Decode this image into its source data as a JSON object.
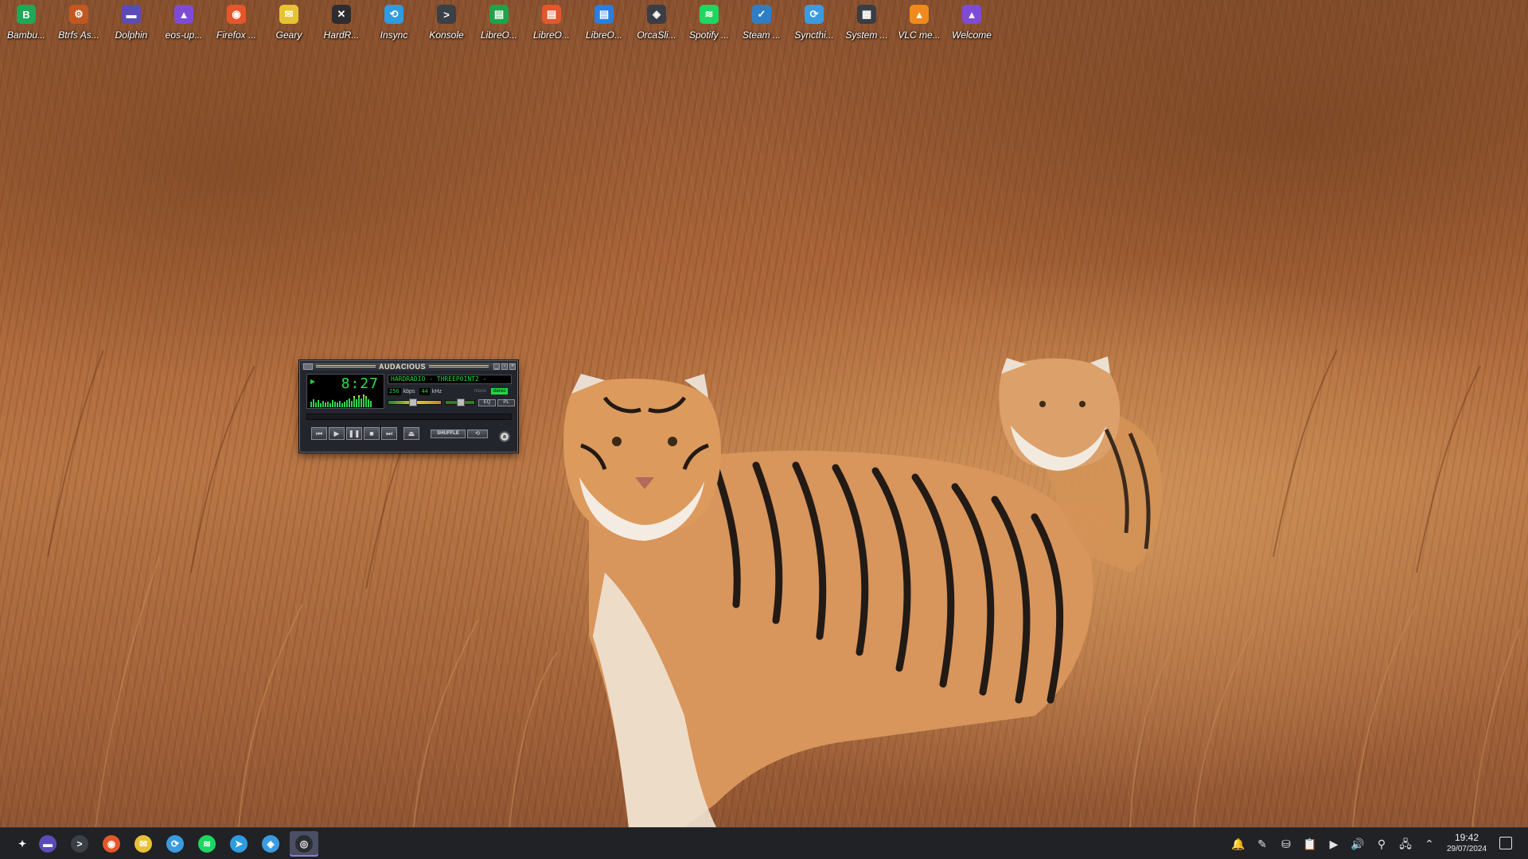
{
  "desktop": {
    "icons": [
      {
        "label": "Bambu...",
        "icon": "bambu-studio-icon",
        "color": "#1fa855",
        "glyph": "B"
      },
      {
        "label": "Btrfs As...",
        "icon": "btrfs-assistant-icon",
        "color": "#c2571f",
        "glyph": "⚙"
      },
      {
        "label": "Dolphin",
        "icon": "dolphin-folder-icon",
        "color": "#5a4bb8",
        "glyph": "▬"
      },
      {
        "label": "eos-up...",
        "icon": "eos-update-icon",
        "color": "#7e4bd6",
        "glyph": "▲"
      },
      {
        "label": "Firefox ...",
        "icon": "firefox-icon",
        "color": "#e5562a",
        "glyph": "◉"
      },
      {
        "label": "Geary",
        "icon": "geary-mail-icon",
        "color": "#e8c235",
        "glyph": "✉"
      },
      {
        "label": "HardR...",
        "icon": "hardrive-icon",
        "color": "#2d2d30",
        "glyph": "✕"
      },
      {
        "label": "Insync",
        "icon": "insync-icon",
        "color": "#2f9be0",
        "glyph": "⟲"
      },
      {
        "label": "Konsole",
        "icon": "konsole-terminal-icon",
        "color": "#3b3f46",
        "glyph": ">"
      },
      {
        "label": "LibreO...",
        "icon": "libreoffice-calc-icon",
        "color": "#1fa34a",
        "glyph": "▤"
      },
      {
        "label": "LibreO...",
        "icon": "libreoffice-impress-icon",
        "color": "#e2572c",
        "glyph": "▤"
      },
      {
        "label": "LibreO...",
        "icon": "libreoffice-writer-icon",
        "color": "#2a7ee0",
        "glyph": "▤"
      },
      {
        "label": "OrcaSli...",
        "icon": "orcaslicer-icon",
        "color": "#3a3d44",
        "glyph": "◈"
      },
      {
        "label": "Spotify ...",
        "icon": "spotify-icon",
        "color": "#1ed760",
        "glyph": "≋"
      },
      {
        "label": "Steam ...",
        "icon": "steam-icon",
        "color": "#2f7ec4",
        "glyph": "✓"
      },
      {
        "label": "Syncthi...",
        "icon": "syncthing-icon",
        "color": "#3b9be0",
        "glyph": "⟳"
      },
      {
        "label": "System ...",
        "icon": "system-monitor-icon",
        "color": "#3a3d44",
        "glyph": "▦"
      },
      {
        "label": "VLC me...",
        "icon": "vlc-cone-icon",
        "color": "#f08a1c",
        "glyph": "▲"
      },
      {
        "label": "Welcome",
        "icon": "welcome-icon",
        "color": "#7e4bd6",
        "glyph": "▲"
      }
    ]
  },
  "player": {
    "title": "AUDACIOUS",
    "time": "8:27",
    "song": "HARDRADIO - THREEPOINT2 -",
    "bitrate": "256",
    "bitrate_unit": "kbps",
    "samplerate": "44",
    "samplerate_unit": "kHz",
    "mono_label": "mono",
    "stereo_label": "stereo",
    "eq_label": "EQ",
    "pl_label": "PL",
    "shuffle_label": "SHUFFLE",
    "volume_level": 0.45,
    "balance_level": 0.5
  },
  "taskbar": {
    "apps": [
      {
        "icon": "app-launcher-icon",
        "glyph": "✦",
        "color": "#202226"
      },
      {
        "icon": "dolphin-folder-icon",
        "glyph": "▬",
        "color": "#5a4bb8"
      },
      {
        "icon": "konsole-terminal-icon",
        "glyph": ">",
        "color": "#3b3f46"
      },
      {
        "icon": "firefox-icon",
        "glyph": "◉",
        "color": "#e5562a"
      },
      {
        "icon": "geary-mail-icon",
        "glyph": "✉",
        "color": "#e8c235"
      },
      {
        "icon": "syncthing-icon",
        "glyph": "⟳",
        "color": "#3b9be0"
      },
      {
        "icon": "spotify-icon",
        "glyph": "≋",
        "color": "#1ed760"
      },
      {
        "icon": "telegram-icon",
        "glyph": "➤",
        "color": "#2f9be0"
      },
      {
        "icon": "orcaslicer-icon",
        "glyph": "◈",
        "color": "#3b9be0"
      },
      {
        "icon": "audacious-icon",
        "glyph": "◎",
        "color": "#2b2d34",
        "active": true
      }
    ],
    "tray": [
      {
        "icon": "notifications-bell-icon",
        "glyph": "🔔"
      },
      {
        "icon": "feather-updates-icon",
        "glyph": "✎"
      },
      {
        "icon": "disk-drive-icon",
        "glyph": "⛁"
      },
      {
        "icon": "clipboard-icon",
        "glyph": "📋"
      },
      {
        "icon": "media-player-icon",
        "glyph": "▶"
      },
      {
        "icon": "volume-icon",
        "glyph": "🔊"
      },
      {
        "icon": "usb-device-icon",
        "glyph": "⚲"
      },
      {
        "icon": "network-icon",
        "glyph": "🖧"
      },
      {
        "icon": "tray-expand-chevron-icon",
        "glyph": "⌃"
      }
    ],
    "clock": {
      "time": "19:42",
      "date": "29/07/2024"
    }
  }
}
